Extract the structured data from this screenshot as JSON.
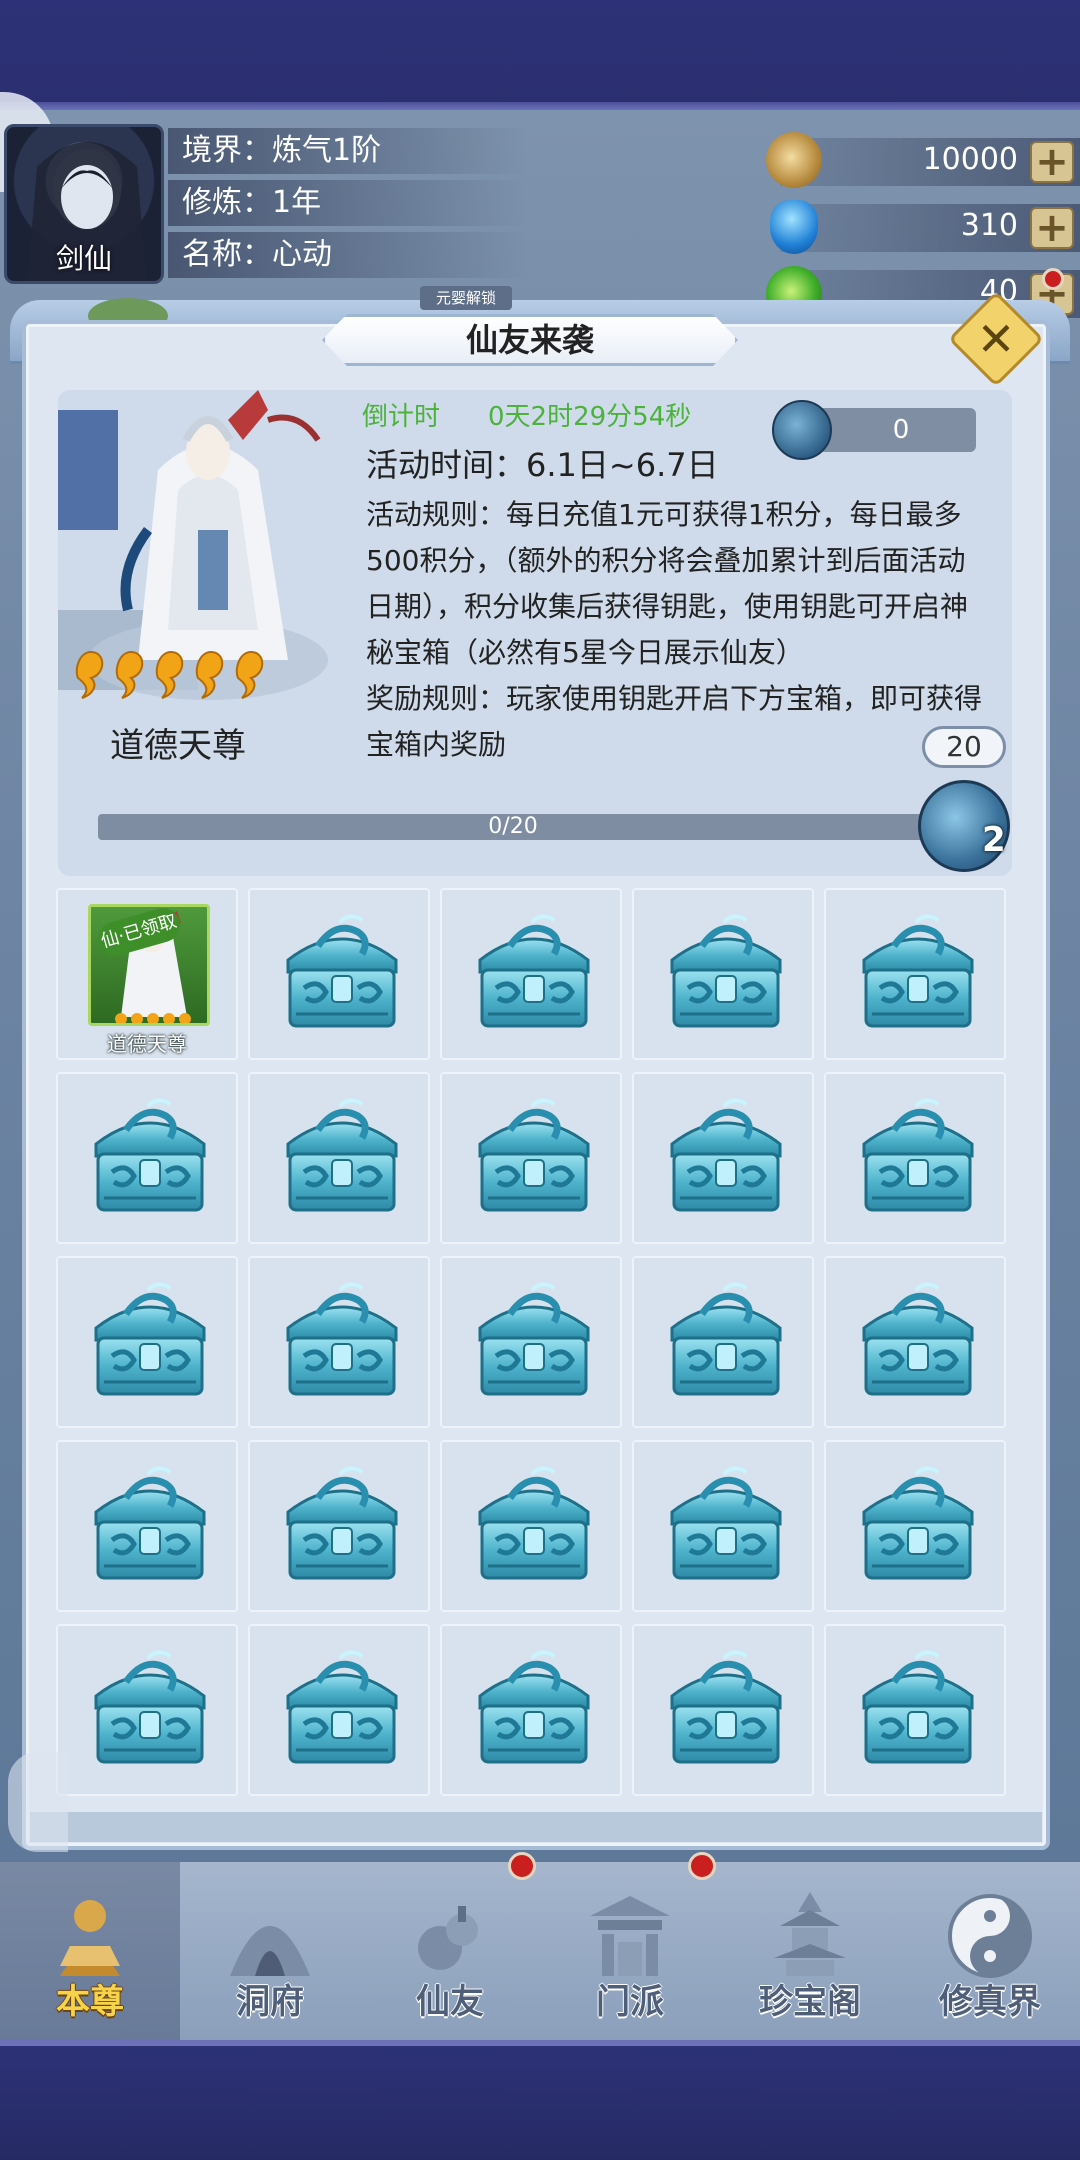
{
  "player": {
    "avatar_label": "剑仙",
    "rows": [
      "境界：炼气1阶",
      "修炼：1年",
      "名称：心动"
    ]
  },
  "resources": [
    {
      "icon": "gold-ingot-icon",
      "value": "10000"
    },
    {
      "icon": "blue-crystal-icon",
      "value": "310"
    },
    {
      "icon": "jade-orb-icon",
      "value": "40"
    }
  ],
  "dialog": {
    "title": "仙友来袭",
    "unlock_tag": "元婴解锁",
    "close_icon": "close-icon",
    "countdown_label": "倒计时",
    "countdown_value": "0天2时29分54秒",
    "activity_time": "活动时间：6.1日~6.7日",
    "rules": "活动规则：每日充值1元可获得1积分，每日最多500积分，（额外的积分将会叠加累计到后面活动日期），积分收集后获得钥匙，使用钥匙可开启神秘宝箱（必然有5星今日展示仙友）",
    "reward_rules": "奖励规则：玩家使用钥匙开启下方宝箱，即可获得宝箱内奖励",
    "key_counter": "0",
    "goal_badge": "20",
    "progress_text": "0/20",
    "progress_fraction": 0,
    "key_count": "2",
    "hero": {
      "name": "道德天尊",
      "stars": 5
    }
  },
  "grid": {
    "reward": {
      "name": "道德天尊",
      "tag": "仙·已领取"
    },
    "chest_count": 24
  },
  "nav": [
    {
      "id": "benzun",
      "label": "本尊",
      "icon": "master-icon",
      "active": true
    },
    {
      "id": "dongfu",
      "label": "洞府",
      "icon": "cave-icon",
      "active": false
    },
    {
      "id": "xianyou",
      "label": "仙友",
      "icon": "gourd-icon",
      "active": false
    },
    {
      "id": "menpai",
      "label": "门派",
      "icon": "sect-gate-icon",
      "active": false
    },
    {
      "id": "zhenbaoge",
      "label": "珍宝阁",
      "icon": "pagoda-icon",
      "active": false
    },
    {
      "id": "xiuzhenjie",
      "label": "修真界",
      "icon": "yin-yang-icon",
      "active": false
    }
  ],
  "colors": {
    "green": "#4bb33a",
    "chest": "#5ab8cf",
    "nav_active": "#f6d34a",
    "red_dot": "#c91f1f"
  }
}
